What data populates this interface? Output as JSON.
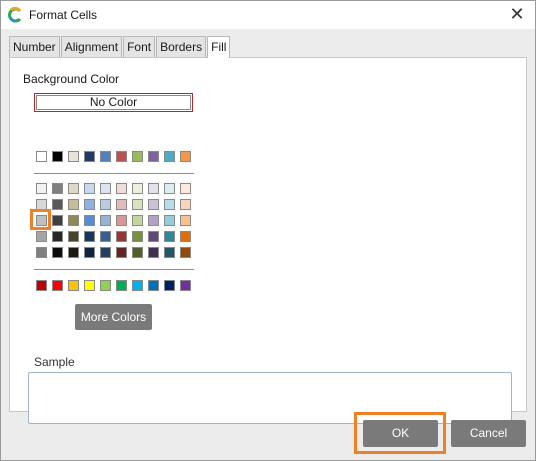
{
  "window": {
    "title": "Format Cells",
    "close_icon": "close-icon",
    "app_icon": "format-app-icon"
  },
  "tabs": [
    {
      "label": "Number",
      "active": false
    },
    {
      "label": "Alignment",
      "active": false
    },
    {
      "label": "Font",
      "active": false
    },
    {
      "label": "Borders",
      "active": false
    },
    {
      "label": "Fill",
      "active": true
    }
  ],
  "fill": {
    "background_color_label": "Background Color",
    "no_color_label": "No Color",
    "theme_top_row": [
      "#ffffff",
      "#000000",
      "#e8e4d8",
      "#1f3a66",
      "#4f81bd",
      "#c0504d",
      "#9bbb59",
      "#8064a2",
      "#4bacc6",
      "#f79646"
    ],
    "theme_shades": [
      [
        "#f2f2f2",
        "#7f7f7f",
        "#ddd9c3",
        "#c6d9f0",
        "#dbe5f1",
        "#f2dcdb",
        "#ebf1dd",
        "#e5e0ec",
        "#dbeef3",
        "#fdeada"
      ],
      [
        "#d8d8d8",
        "#595959",
        "#c4bd97",
        "#8db3e2",
        "#b8cce4",
        "#e5b9b7",
        "#d7e3bc",
        "#ccc1d9",
        "#b7dde8",
        "#fbd5b5"
      ],
      [
        "#bfbfbf",
        "#3f3f3f",
        "#938953",
        "#548dd4",
        "#95b3d7",
        "#d99694",
        "#c3d69b",
        "#b2a2c7",
        "#92cddc",
        "#fac08f"
      ],
      [
        "#a5a5a5",
        "#262626",
        "#494429",
        "#17365d",
        "#366092",
        "#953734",
        "#76923c",
        "#5f497a",
        "#31859b",
        "#e36c09"
      ],
      [
        "#7f7f7f",
        "#0c0c0c",
        "#1d1b10",
        "#0f243e",
        "#244061",
        "#632423",
        "#4f6128",
        "#3f3151",
        "#205867",
        "#974806"
      ]
    ],
    "standard_colors": [
      "#c00000",
      "#ff0000",
      "#ffc000",
      "#ffff00",
      "#92d050",
      "#00b050",
      "#00b0f0",
      "#0070c0",
      "#002060",
      "#7030a0"
    ],
    "selected_color": "#bfbfbf",
    "more_colors_label": "More Colors",
    "sample_label": "Sample"
  },
  "buttons": {
    "ok_label": "OK",
    "cancel_label": "Cancel"
  },
  "colors": {
    "highlight": "#f08025",
    "button_gray": "#7a7a7a",
    "no_color_border": "#b02a2a"
  }
}
